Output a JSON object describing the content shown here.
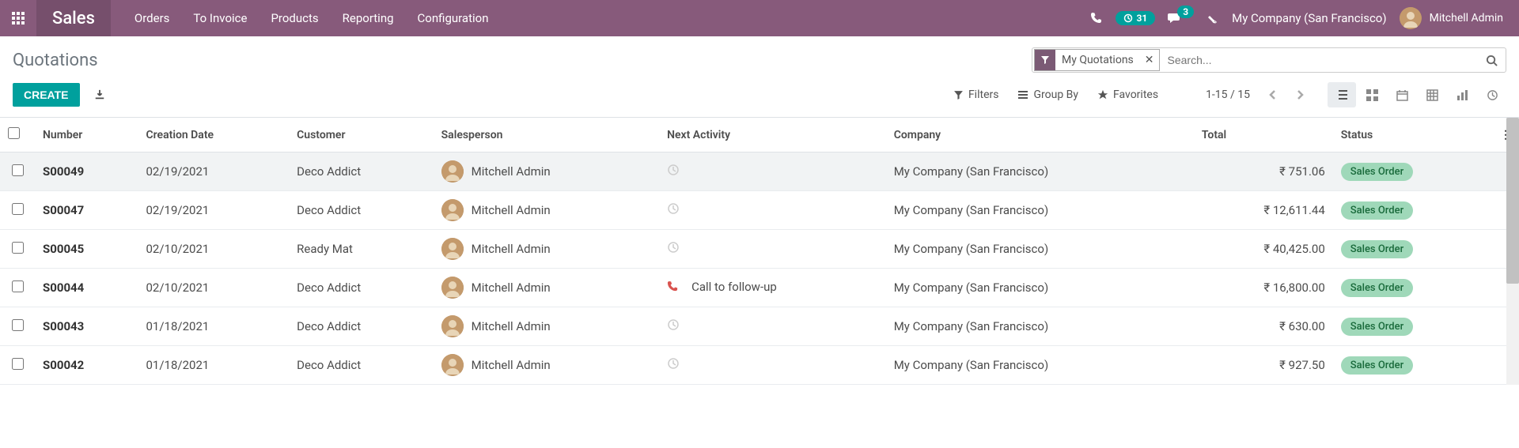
{
  "nav": {
    "brand": "Sales",
    "items": [
      "Orders",
      "To Invoice",
      "Products",
      "Reporting",
      "Configuration"
    ],
    "activity_count": "31",
    "msg_count": "3",
    "company": "My Company (San Francisco)",
    "user": "Mitchell Admin"
  },
  "cp": {
    "breadcrumb": "Quotations",
    "chip_label": "My Quotations",
    "search_placeholder": "Search...",
    "create": "CREATE",
    "filters": "Filters",
    "groupby": "Group By",
    "favorites": "Favorites",
    "pager": "1-15 / 15"
  },
  "table": {
    "headers": {
      "number": "Number",
      "creation_date": "Creation Date",
      "customer": "Customer",
      "salesperson": "Salesperson",
      "next_activity": "Next Activity",
      "company": "Company",
      "total": "Total",
      "status": "Status"
    },
    "rows": [
      {
        "number": "S00049",
        "date": "02/19/2021",
        "customer": "Deco Addict",
        "salesperson": "Mitchell Admin",
        "activity": "",
        "activity_icon": "clock",
        "company": "My Company (San Francisco)",
        "total": "₹ 751.06",
        "status": "Sales Order",
        "hl": true
      },
      {
        "number": "S00047",
        "date": "02/19/2021",
        "customer": "Deco Addict",
        "salesperson": "Mitchell Admin",
        "activity": "",
        "activity_icon": "clock",
        "company": "My Company (San Francisco)",
        "total": "₹ 12,611.44",
        "status": "Sales Order"
      },
      {
        "number": "S00045",
        "date": "02/10/2021",
        "customer": "Ready Mat",
        "salesperson": "Mitchell Admin",
        "activity": "",
        "activity_icon": "clock",
        "company": "My Company (San Francisco)",
        "total": "₹ 40,425.00",
        "status": "Sales Order"
      },
      {
        "number": "S00044",
        "date": "02/10/2021",
        "customer": "Deco Addict",
        "salesperson": "Mitchell Admin",
        "activity": "Call to follow-up",
        "activity_icon": "phone",
        "company": "My Company (San Francisco)",
        "total": "₹ 16,800.00",
        "status": "Sales Order"
      },
      {
        "number": "S00043",
        "date": "01/18/2021",
        "customer": "Deco Addict",
        "salesperson": "Mitchell Admin",
        "activity": "",
        "activity_icon": "clock",
        "company": "My Company (San Francisco)",
        "total": "₹ 630.00",
        "status": "Sales Order"
      },
      {
        "number": "S00042",
        "date": "01/18/2021",
        "customer": "Deco Addict",
        "salesperson": "Mitchell Admin",
        "activity": "",
        "activity_icon": "clock",
        "company": "My Company (San Francisco)",
        "total": "₹ 927.50",
        "status": "Sales Order"
      }
    ]
  }
}
